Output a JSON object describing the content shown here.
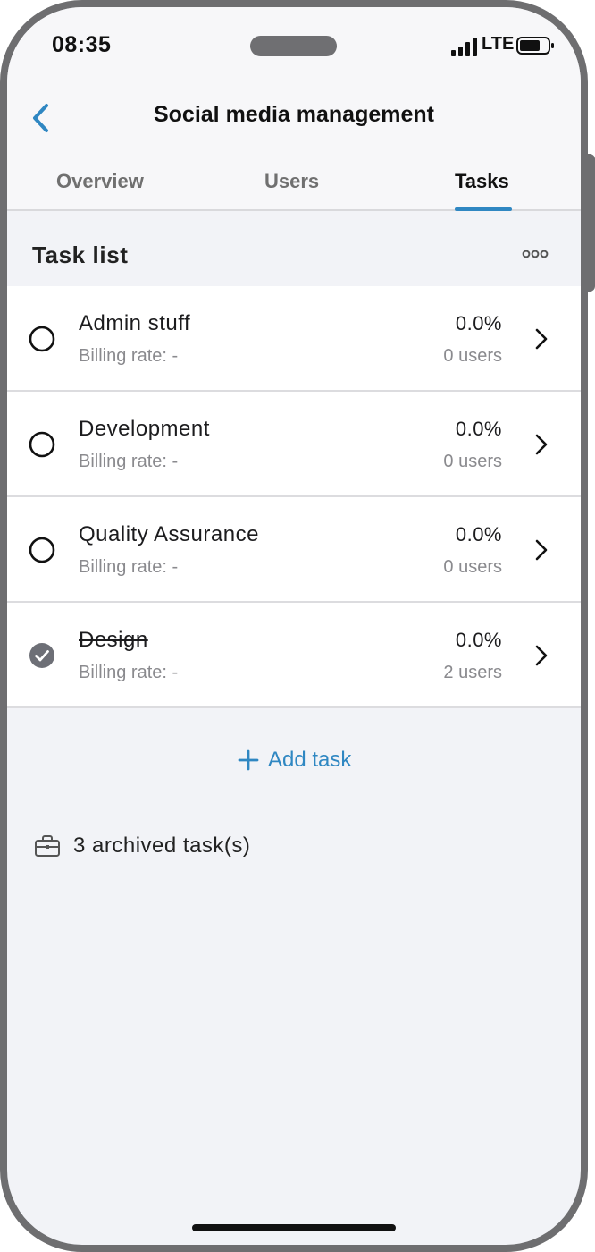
{
  "status_bar": {
    "time": "08:35",
    "network": "LTE",
    "icons": [
      "signal-icon",
      "battery-icon"
    ]
  },
  "header": {
    "title": "Social media management",
    "back_icon": "chevron-left-icon"
  },
  "tabs": [
    {
      "label": "Overview",
      "active": false
    },
    {
      "label": "Users",
      "active": false
    },
    {
      "label": "Tasks",
      "active": true
    }
  ],
  "task_list": {
    "title": "Task list",
    "more_icon": "more-icon",
    "tasks": [
      {
        "name": "Admin stuff",
        "billing": "Billing rate: -",
        "percent": "0.0%",
        "users": "0 users",
        "completed": false
      },
      {
        "name": "Development",
        "billing": "Billing rate: -",
        "percent": "0.0%",
        "users": "0 users",
        "completed": false
      },
      {
        "name": "Quality Assurance",
        "billing": "Billing rate: -",
        "percent": "0.0%",
        "users": "0 users",
        "completed": false
      },
      {
        "name": "Design",
        "billing": "Billing rate: -",
        "percent": "0.0%",
        "users": "2 users",
        "completed": true
      }
    ]
  },
  "add_task": {
    "label": "Add task",
    "icon": "plus-icon"
  },
  "archived": {
    "label": "3 archived task(s)",
    "icon": "briefcase-icon"
  },
  "colors": {
    "accent": "#2f87c2",
    "background": "#f2f3f7",
    "row_background": "#ffffff",
    "muted_text": "#8a8a8e",
    "frame": "#6e6e70"
  }
}
